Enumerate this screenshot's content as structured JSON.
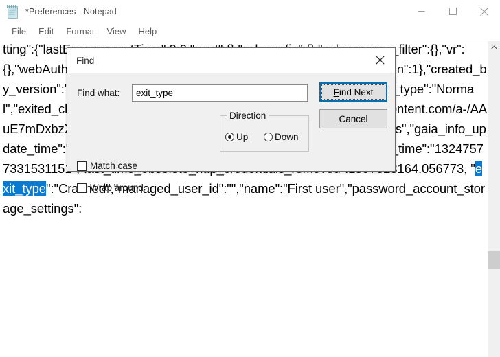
{
  "window": {
    "title": "*Preferences - Notepad",
    "icon": "notepad-icon",
    "controls": {
      "minimize": "minimize-icon",
      "maximize": "maximize-icon",
      "close": "close-icon"
    }
  },
  "menu": {
    "items": [
      {
        "label": "File"
      },
      {
        "label": "Edit"
      },
      {
        "label": "Format"
      },
      {
        "label": "View"
      },
      {
        "label": "Help"
      }
    ]
  },
  "editor": {
    "text_before_selection": "tting\":{\"lastEngagementTime\":0.0,\"post\":{},\"ssl_config\":{},\"subresource_filter\":{},\"vr\":{},\"webAuthnAboutLaunchTime\":1304}}},\"sound_guard\":{}},\"pref_version\":1},\"created_by_version\":\"77.0.3865.75\",\"creation_time\":\"13212731031995484\",\"exit_type\":\"Normal\",\"exited_cleanly\":true,\"gaia_info_picture_url\":\"https://lh3.googleusercontent.com/a-/AAuE7mDxbzX7dnSwdnZKGbkNwx3_z1FkcICyB8eTCKZZMrs=s256-c-ns\",\"gaia_info_update_time\":\"13223317744667605\",\"icon_version\":6,\"last_engagement_time\":\"13247577331531151\",\"last_time_obsolete_http_credentials_removed\":1597823164.056773, \"",
    "selected_text": "exit_type",
    "text_after_selection": "\":\"Crashed\",\"managed_user_id\":\"\",\"name\":\"First user\",\"password_account_storage_settings\":",
    "selection_color": "#0a7ad0",
    "visible_lines": [
      "tting\":",
      "{\"lastEngagementTime\":0.0,\"post\":{},\"ssl_config\":{},\"subresource_filter\":{},\"vr\":{},\"webAuthnAboutLaunchTime\":1304}}},\"sound_guard\":{}},\"pref_version\":1},\"created_by_version\":\"77.0.3865.75\",\"creation_time\":\"13212731031995484\",\"exit_type\":\"Normal\",\"exited_cleanly\":true,",
      "\"gaia_info_picture_url\":\"https://lh3.googleusercontent.com/a-/AAuE7mDxbzX7dnSwdnZKGbkNwx3_z1FkcICyB8eTCKZZMrs=s256-c-ns\",\"gaia_info_update_time\":\"13223317744667605\",\"icon_version\":6,",
      "\"last_engagement_time\":\"13247577331531151\",\"last_time_obsolete_http_credentials_removed\":1597823164.056773, \"exit_type\":\"Crashed\",",
      "\"managed_user_id\":\"\",\"name\":\"First user\",\"password_account_storage_settings\":"
    ]
  },
  "scrollbar": {
    "up_arrow": "chevron-up-icon"
  },
  "find_dialog": {
    "title": "Find",
    "close_icon": "close-icon",
    "find_what_label_pre": "Fi",
    "find_what_label_accel": "n",
    "find_what_label_post": "d what:",
    "find_what_value": "exit_type",
    "find_what_placeholder": "",
    "find_next": {
      "pre": "",
      "accel": "F",
      "post": "ind Next",
      "full_label": "Find Next"
    },
    "cancel_label": "Cancel",
    "direction": {
      "legend": "Direction",
      "options": [
        {
          "pre": "",
          "accel": "U",
          "post": "p",
          "label": "Up",
          "checked": true
        },
        {
          "pre": "",
          "accel": "D",
          "post": "own",
          "label": "Down",
          "checked": false
        }
      ]
    },
    "match_case": {
      "pre": "Match ",
      "accel": "c",
      "post": "ase",
      "label": "Match case",
      "checked": false
    },
    "wrap_around": {
      "pre": "W",
      "accel": "r",
      "post": "ap around",
      "label": "Wrap around",
      "checked": false
    }
  }
}
